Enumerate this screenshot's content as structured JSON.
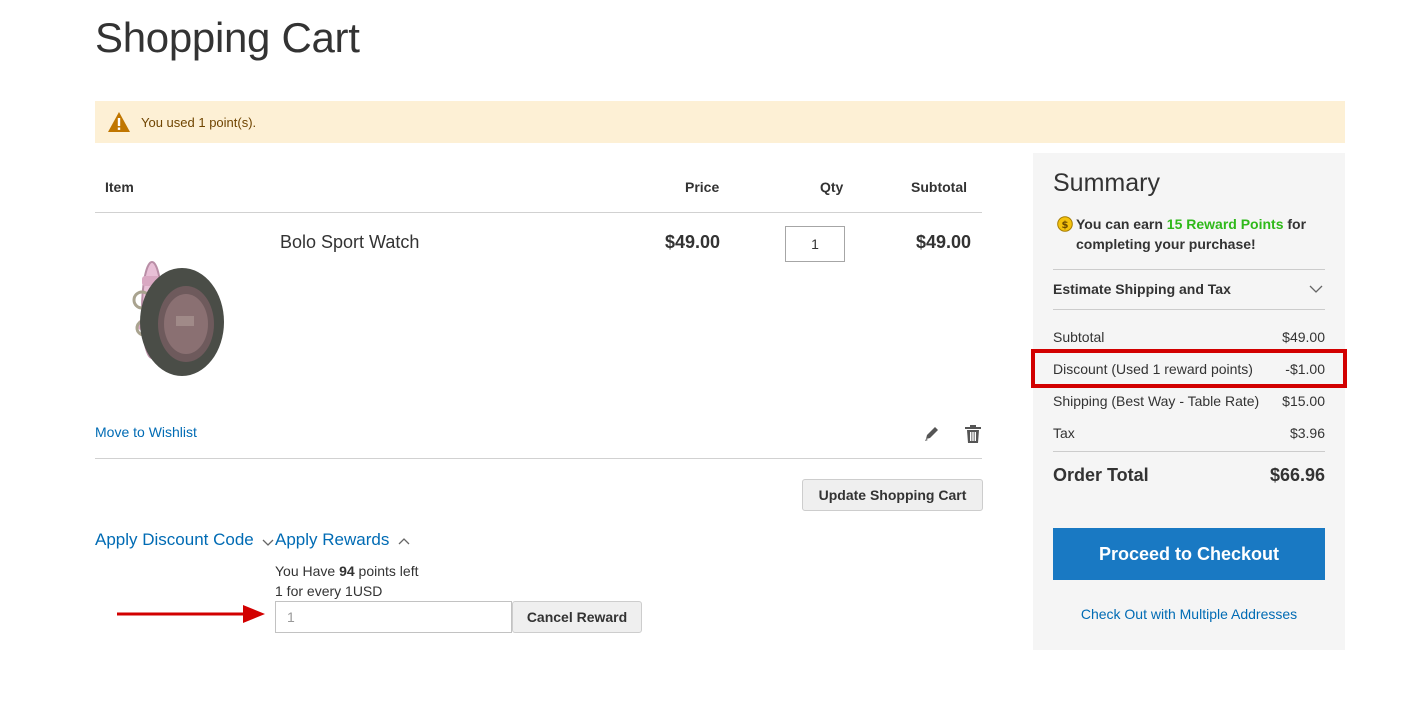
{
  "page": {
    "title": "Shopping Cart"
  },
  "notice": {
    "message": "You used 1 point(s).",
    "icon": "warning-icon",
    "color": "#fdf0d5"
  },
  "cart": {
    "headers": {
      "item": "Item",
      "price": "Price",
      "qty": "Qty",
      "subtotal": "Subtotal"
    },
    "items": [
      {
        "name": "Bolo Sport Watch",
        "price": "$49.00",
        "qty": "1",
        "subtotal": "$49.00"
      }
    ],
    "move_to_wishlist": "Move to Wishlist",
    "update_button": "Update Shopping Cart"
  },
  "discount": {
    "title": "Apply Discount Code"
  },
  "rewards": {
    "title": "Apply Rewards",
    "have_prefix": "You Have ",
    "points": "94",
    "have_suffix": " points left",
    "rate": "1 for every 1USD",
    "input_value": "1",
    "cancel_button": "Cancel Reward"
  },
  "summary": {
    "title": "Summary",
    "earn_prefix": "You can earn ",
    "earn_points": "15 Reward Points",
    "earn_suffix": " for completing your purchase!",
    "estimate": "Estimate Shipping and Tax",
    "rows": [
      {
        "label": "Subtotal",
        "value": "$49.00"
      },
      {
        "label": "Discount (Used 1 reward points)",
        "value": "-$1.00"
      },
      {
        "label": "Shipping (Best Way - Table Rate)",
        "value": "$15.00"
      },
      {
        "label": "Tax",
        "value": "$3.96"
      }
    ],
    "order_total_label": "Order Total",
    "order_total_value": "$66.96",
    "checkout_button": "Proceed to Checkout",
    "multiple_addresses": "Check Out with Multiple Addresses"
  },
  "colors": {
    "accent": "#1979c3",
    "link": "#006bb4",
    "reward_green": "#2fb91a",
    "highlight_red": "#d20000"
  }
}
